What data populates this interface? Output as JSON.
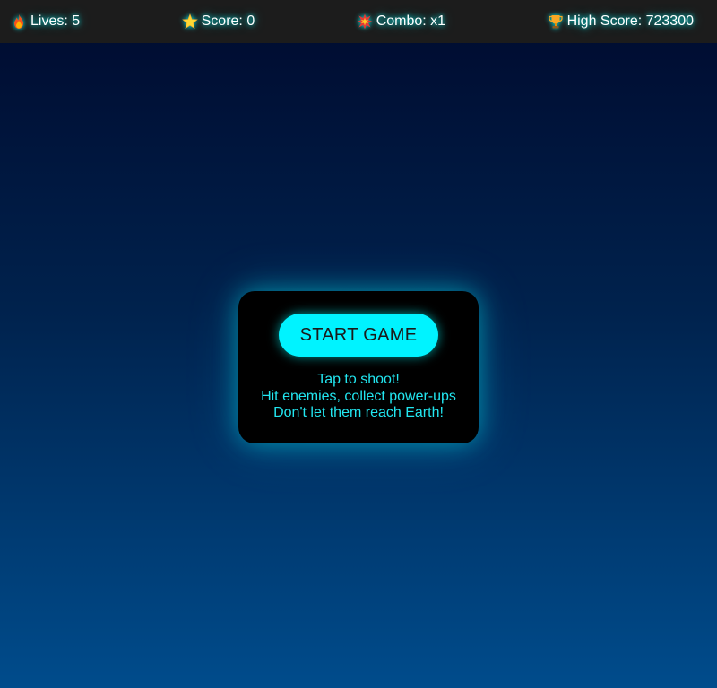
{
  "hud": {
    "lives": {
      "label": "Lives: 5",
      "icon": "fire-icon"
    },
    "score": {
      "label": "Score: 0",
      "icon": "star-icon"
    },
    "combo": {
      "label": "Combo: x1",
      "icon": "explosion-icon"
    },
    "high_score": {
      "label": "High Score: 723300",
      "icon": "trophy-icon"
    }
  },
  "menu": {
    "start_label": "START GAME",
    "instructions": [
      "Tap to shoot!",
      "Hit enemies, collect power-ups",
      "Don't let them reach Earth!"
    ]
  },
  "colors": {
    "accent": "#00f3ff",
    "hud_bg": "#1c1c1c",
    "sky_top": "#000a2e",
    "sky_bottom": "#004c8c"
  }
}
